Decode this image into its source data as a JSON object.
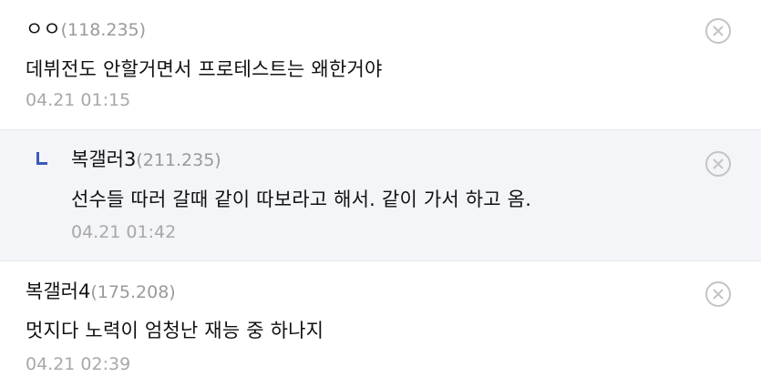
{
  "comments": [
    {
      "nickname": "ㅇㅇ",
      "ip": "(118.235)",
      "text": "데뷔전도 안할거면서 프로테스트는 왜한거야",
      "timestamp": "04.21 01:15",
      "is_reply": false
    },
    {
      "nickname": "복갤러3",
      "ip": "(211.235)",
      "text": "선수들 따러 갈때 같이 따보라고 해서. 같이 가서 하고 옴.",
      "timestamp": "04.21 01:42",
      "is_reply": true
    },
    {
      "nickname": "복갤러4",
      "ip": "(175.208)",
      "text": "멋지다 노력이 엄청난 재능 중 하나지",
      "timestamp": "04.21 02:39",
      "is_reply": false
    }
  ],
  "icons": {
    "delete": "close-circle-icon",
    "reply": "reply-corner-icon"
  },
  "colors": {
    "reply_background": "#f4f5f8",
    "reply_marker": "#3b5bb8",
    "meta_text": "#a8a8a8",
    "icon_gray": "#c4c4c4"
  }
}
